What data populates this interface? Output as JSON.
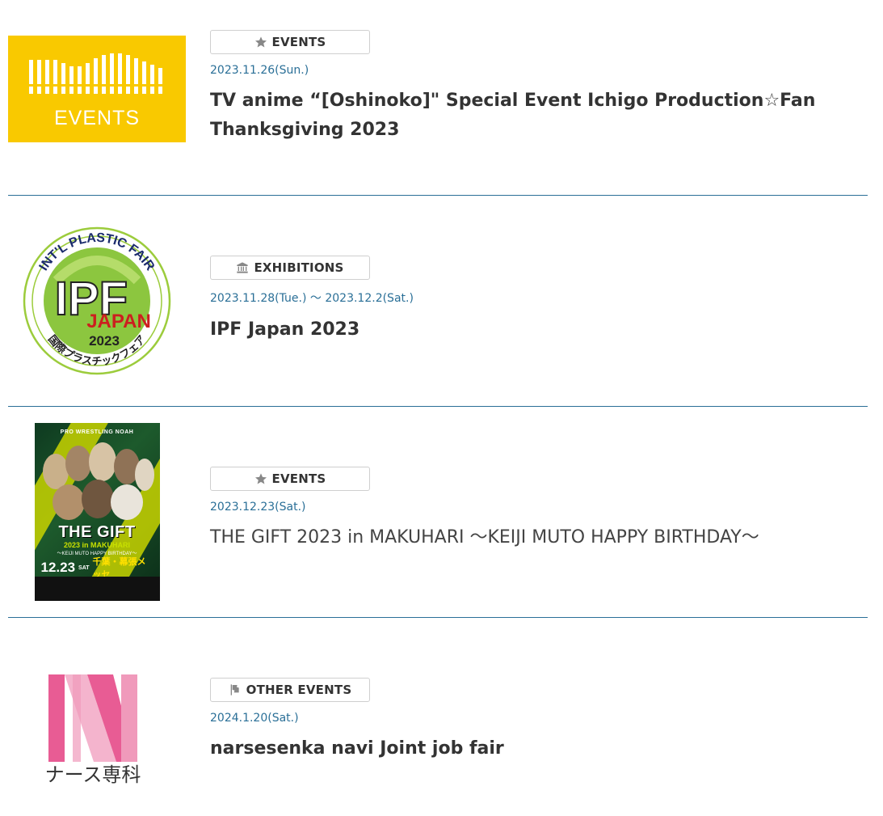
{
  "items": [
    {
      "category": "EVENTS",
      "category_icon": "star-icon",
      "date": "2023.11.26(Sun.)",
      "title": "TV anime “[Oshinoko]\" Special Event Ichigo Production☆Fan Thanksgiving 2023",
      "thumb_label": "EVENTS"
    },
    {
      "category": "EXHIBITIONS",
      "category_icon": "museum-icon",
      "date": "2023.11.28(Tue.) ～ 2023.12.2(Sat.)",
      "title": "IPF Japan 2023",
      "logo": {
        "top_text": "INT'L PLASTIC FAIR",
        "big": "IPF",
        "country": "JAPAN",
        "year": "2023",
        "bottom_text": "国際プラスチックフェア"
      }
    },
    {
      "category": "EVENTS",
      "category_icon": "star-icon",
      "date": "2023.12.23(Sat.)",
      "title": "THE GIFT 2023 in MAKUHARI ～KEIJI MUTO HAPPY BIRTHDAY～",
      "poster": {
        "header": "PRO WRESTLING NOAH",
        "main": "THE GIFT",
        "sub1": "2023 in MAKUHARI",
        "sub2": "～KEIJI MUTO HAPPY BIRTHDAY～",
        "date": "12.23",
        "day": "SAT",
        "venue": "千葉・幕張メッセ"
      }
    },
    {
      "category": "OTHER EVENTS",
      "category_icon": "flag-icon",
      "date": "2024.1.20(Sat.)",
      "title": "narsesenka navi Joint job fair",
      "logo_text": "ナース専科"
    }
  ],
  "colors": {
    "accent": "#2a6f97",
    "events_yellow": "#f9c900",
    "pink": "#e85c94"
  }
}
